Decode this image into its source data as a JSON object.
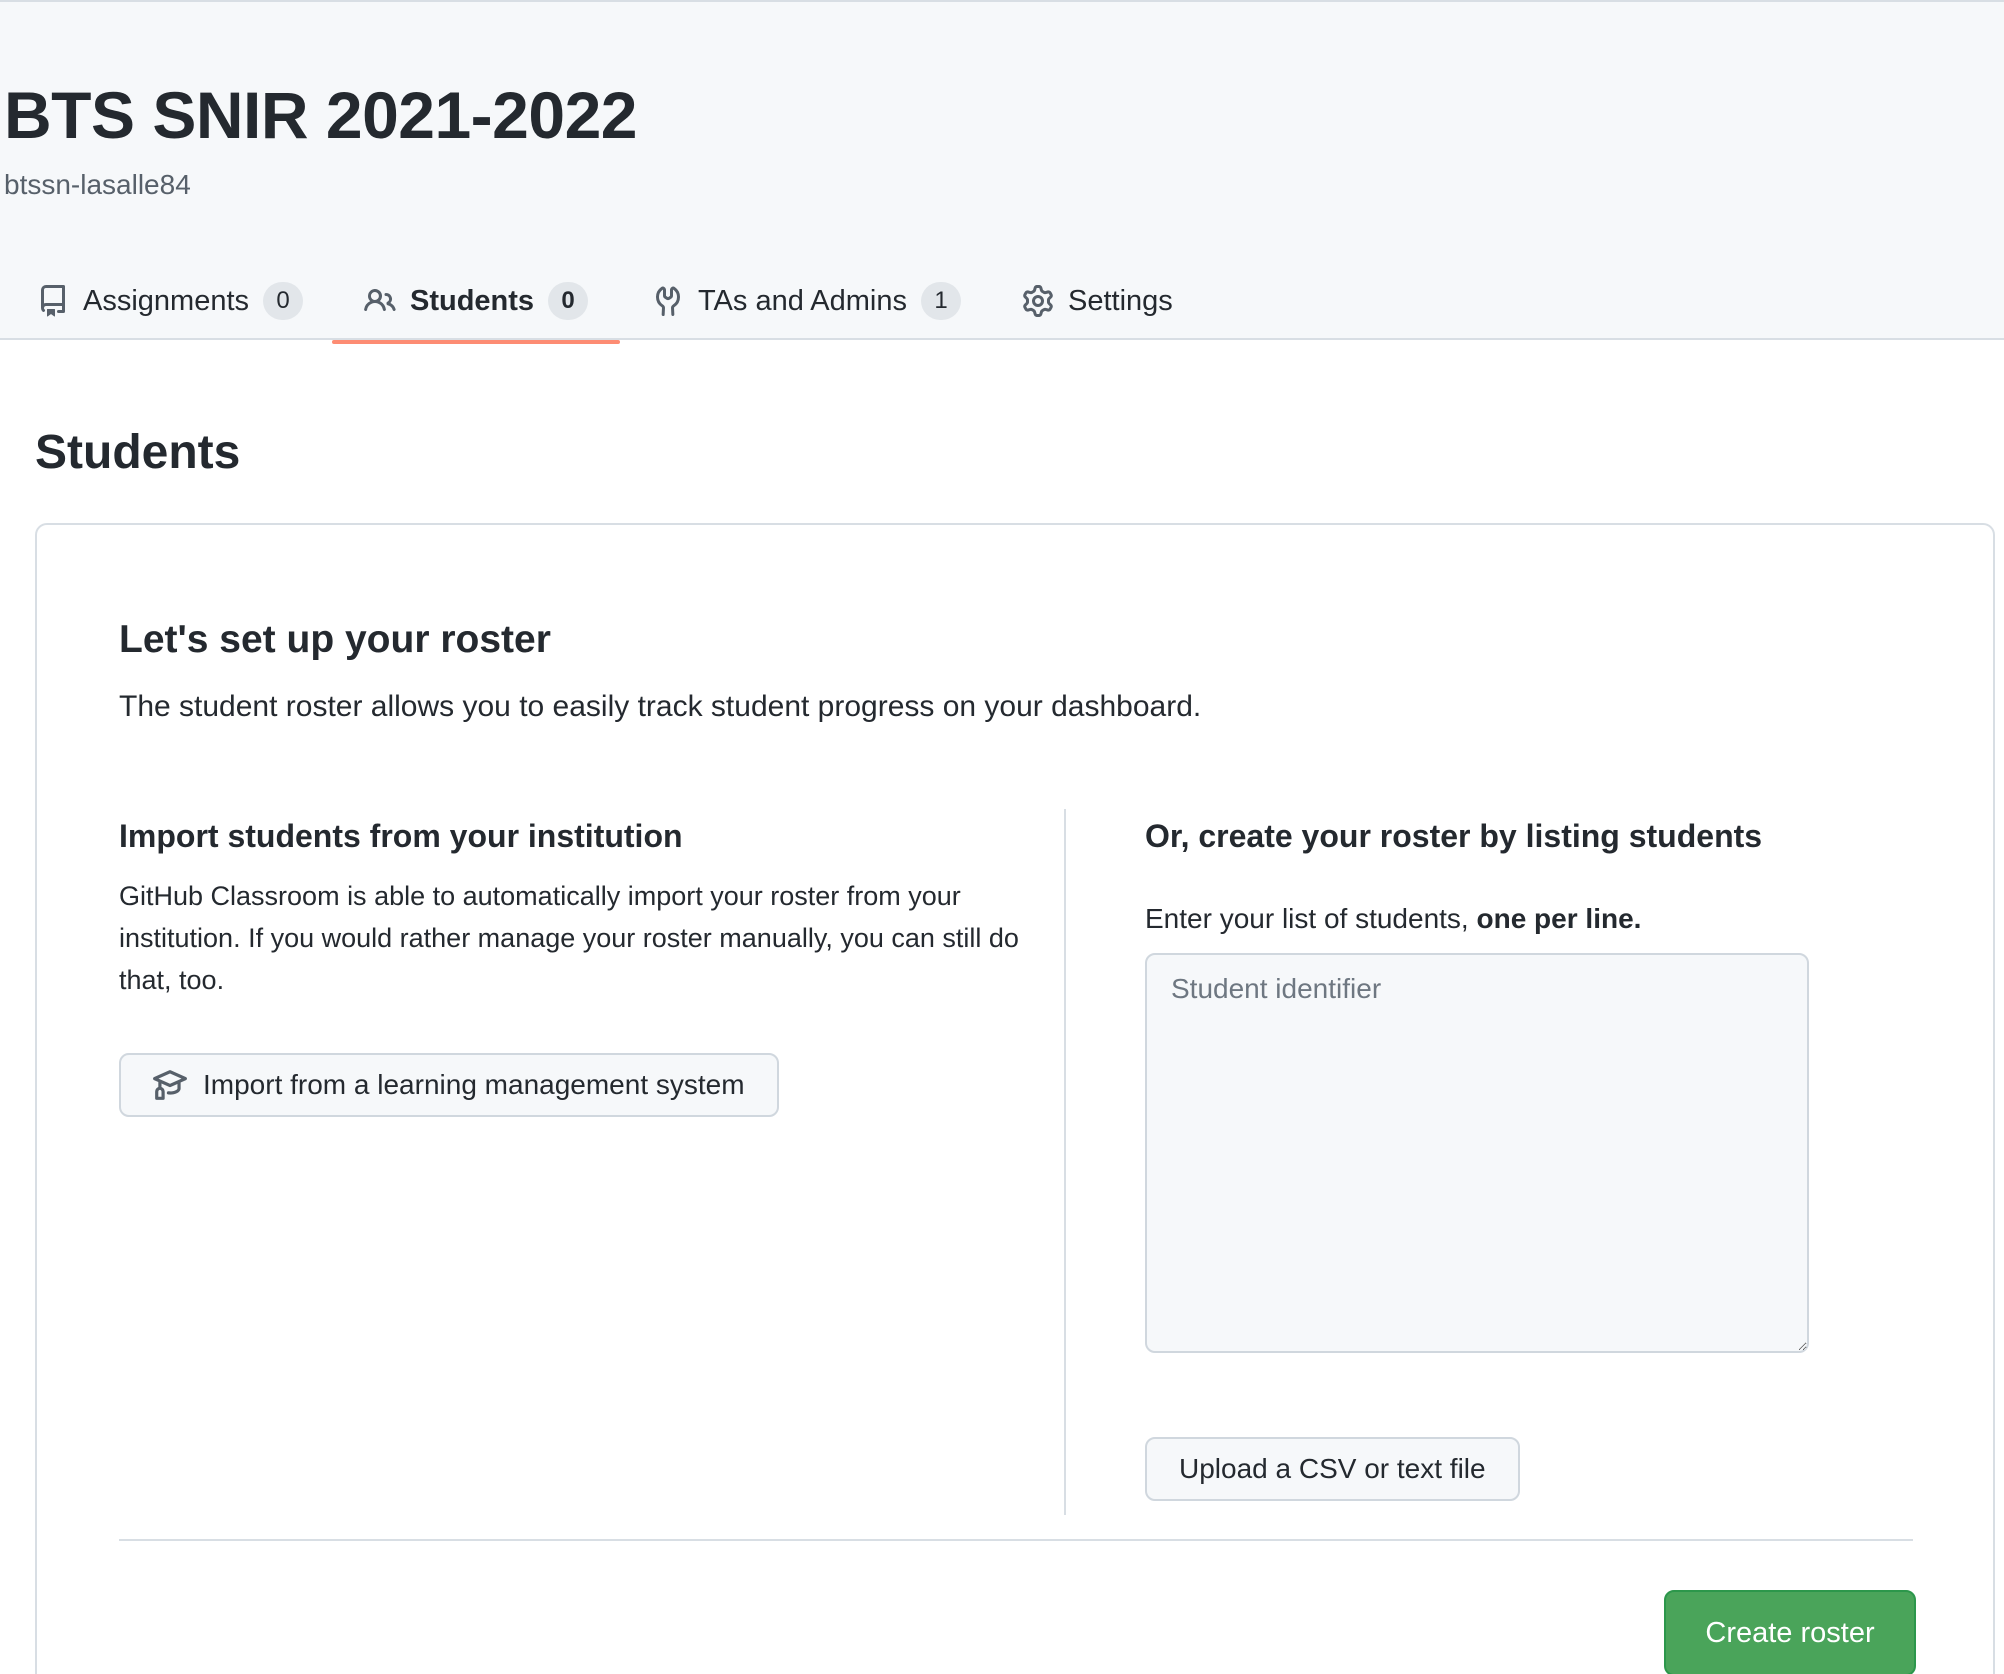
{
  "header": {
    "org_title": "BTS SNIR 2021-2022",
    "org_login": "btssn-lasalle84"
  },
  "tabs": [
    {
      "label": "Assignments",
      "count": "0",
      "icon": "repo-icon",
      "selected": false
    },
    {
      "label": "Students",
      "count": "0",
      "icon": "people-icon",
      "selected": true
    },
    {
      "label": "TAs and Admins",
      "count": "1",
      "icon": "tools-icon",
      "selected": false
    },
    {
      "label": "Settings",
      "count": null,
      "icon": "gear-icon",
      "selected": false
    }
  ],
  "page": {
    "heading": "Students"
  },
  "roster_setup": {
    "title": "Let's set up your roster",
    "description": "The student roster allows you to easily track student progress on your dashboard.",
    "import": {
      "title": "Import students from your institution",
      "text": "GitHub Classroom is able to automatically import your roster from your institution. If you would rather manage your roster manually, you can still do that, too.",
      "button_label": "Import from a learning management system",
      "button_icon": "mortar-board-icon"
    },
    "manual": {
      "title": "Or, create your roster by listing students",
      "label_prefix": "Enter your list of students, ",
      "label_emphasis": "one per line.",
      "textarea_placeholder": "Student identifier",
      "textarea_value": "",
      "upload_button_label": "Upload a CSV or text file"
    },
    "create_button_label": "Create roster"
  },
  "colors": {
    "header_bg": "#f6f8fa",
    "tab_underline": "#fd8c73",
    "primary_button": "#4aa45a",
    "border": "#d8dee4"
  }
}
